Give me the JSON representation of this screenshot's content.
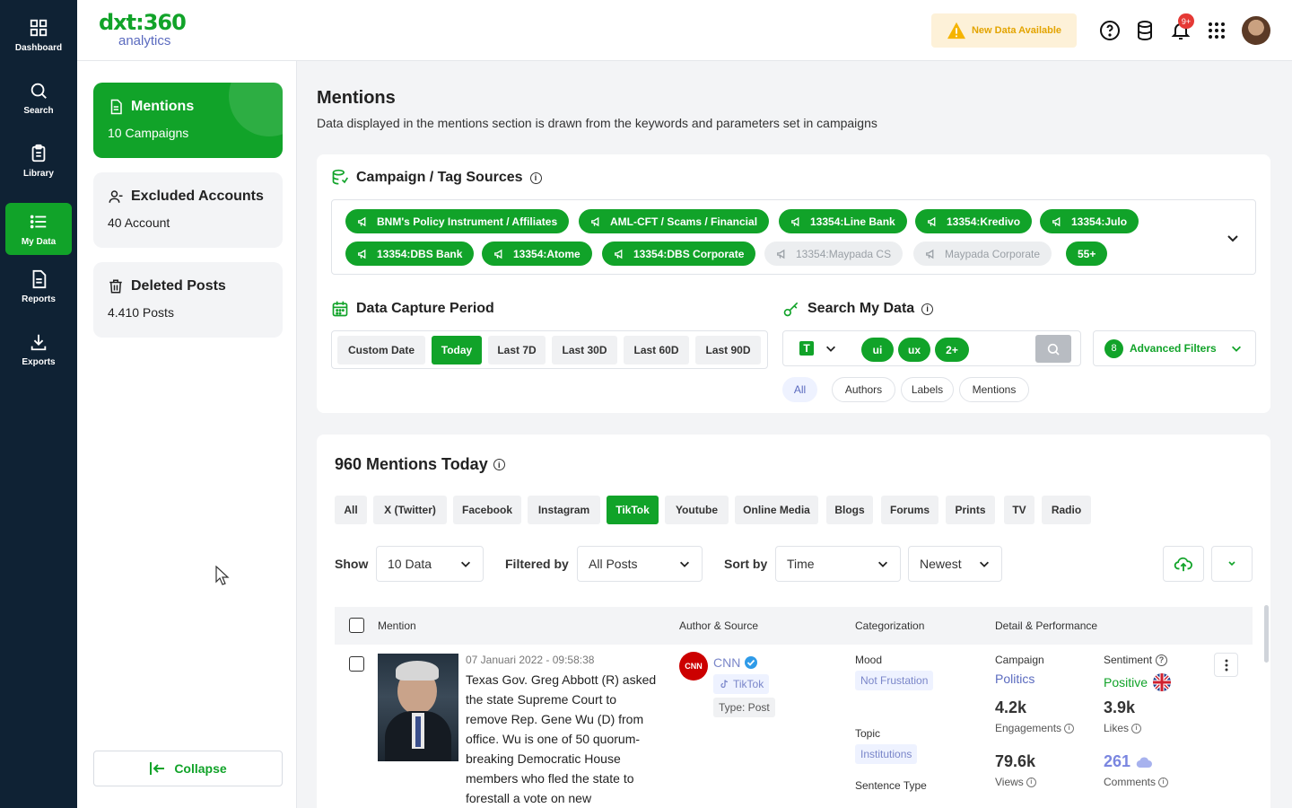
{
  "nav": {
    "items": [
      {
        "label": "Dashboard",
        "icon": "grid-icon"
      },
      {
        "label": "Search",
        "icon": "search-icon"
      },
      {
        "label": "Library",
        "icon": "clipboard-icon"
      },
      {
        "label": "My Data",
        "icon": "list-icon",
        "active": true
      },
      {
        "label": "Reports",
        "icon": "document-icon"
      },
      {
        "label": "Exports",
        "icon": "download-icon"
      }
    ]
  },
  "brand": {
    "logo_top": "dxt:360",
    "logo_bottom": "analytics",
    "color": "#11a329"
  },
  "header": {
    "new_data_label": "New Data Available",
    "notification_count": "9+"
  },
  "sidebar": {
    "cards": [
      {
        "title": "Mentions",
        "sub": "10 Campaigns",
        "icon": "document-icon"
      },
      {
        "title": "Excluded Accounts",
        "sub": "40 Account",
        "icon": "user-minus-icon"
      },
      {
        "title": "Deleted Posts",
        "sub": "4.410 Posts",
        "icon": "trash-icon"
      }
    ],
    "collapse_label": "Collapse"
  },
  "page": {
    "title": "Mentions",
    "subtitle": "Data displayed in the mentions section is drawn from the keywords and parameters set in campaigns"
  },
  "sources": {
    "title": "Campaign / Tag Sources",
    "tags": [
      {
        "label": "BNM's Policy Instrument / Affiliates",
        "active": true
      },
      {
        "label": "AML-CFT / Scams / Financial",
        "active": true
      },
      {
        "label": "13354:Line Bank",
        "active": true
      },
      {
        "label": "13354:Kredivo",
        "active": true
      },
      {
        "label": "13354:Julo",
        "active": true
      },
      {
        "label": "13354:DBS Bank",
        "active": true
      },
      {
        "label": "13354:Atome",
        "active": true
      },
      {
        "label": "13354:DBS Corporate",
        "active": true
      },
      {
        "label": "13354:Maypada CS",
        "active": false
      },
      {
        "label": "Maypada Corporate",
        "active": false
      }
    ],
    "more_label": "55+"
  },
  "period": {
    "title": "Data Capture Period",
    "options": [
      "Custom Date",
      "Today",
      "Last 7D",
      "Last 30D",
      "Last 60D",
      "Last 90D"
    ],
    "selected": "Today"
  },
  "search_data": {
    "title": "Search My Data",
    "type_icon": "T",
    "keywords": [
      "ui",
      "ux",
      "2+"
    ],
    "filters_count": "8",
    "advanced_label": "Advanced Filters",
    "scopes": [
      "All",
      "Authors",
      "Labels",
      "Mentions"
    ],
    "selected_scope": "All"
  },
  "mentions": {
    "title": "960 Mentions Today",
    "platforms": [
      "All",
      "X (Twitter)",
      "Facebook",
      "Instagram",
      "TikTok",
      "Youtube",
      "Online Media",
      "Blogs",
      "Forums",
      "Prints",
      "TV",
      "Radio"
    ],
    "selected_platform": "TikTok",
    "show_label": "Show",
    "show_value": "10 Data",
    "filtered_label": "Filtered by",
    "filtered_value": "All Posts",
    "sort_label": "Sort by",
    "sort_value": "Time",
    "order_value": "Newest",
    "columns": [
      "Mention",
      "Author & Source",
      "Categorization",
      "Detail & Performance"
    ]
  },
  "row": {
    "timestamp": "07 Januari 2022 - 09:58:38",
    "text_lines": [
      "Texas Gov. Greg Abbott (R) asked",
      "the state Supreme Court to",
      "remove Rep. Gene Wu (D) from",
      "office. Wu is one of 50 quorum-",
      "breaking Democratic House",
      "members who fled the state to",
      "forestall a vote on new"
    ],
    "author": "CNN",
    "author_logo": "CNN",
    "platform": "TikTok",
    "type": "Type: Post",
    "mood_label": "Mood",
    "mood": "Not Frustation",
    "topic_label": "Topic",
    "topic": "Institutions",
    "sentence_label": "Sentence Type",
    "campaign_label": "Campaign",
    "campaign": "Politics",
    "sentiment_label": "Sentiment",
    "sentiment": "Positive",
    "engagements": "4.2k",
    "engagements_label": "Engagements",
    "likes": "3.9k",
    "likes_label": "Likes",
    "views": "79.6k",
    "views_label": "Views",
    "comments": "261",
    "comments_label": "Comments",
    "sentiment_color": "#11a329",
    "link_color": "#5b6bbf"
  }
}
